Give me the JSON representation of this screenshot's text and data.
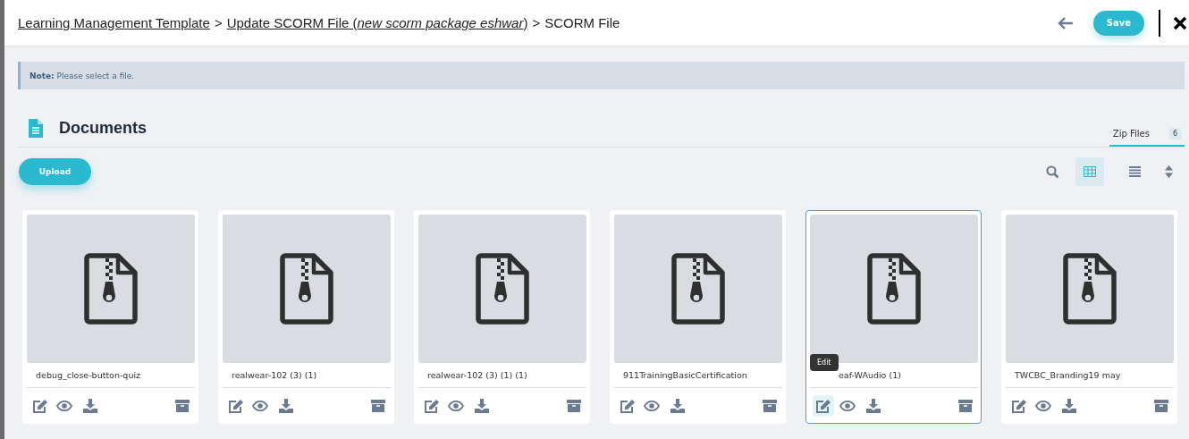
{
  "breadcrumb": {
    "links": [
      "Learning Management Template",
      "Update SCORM File (*new scorm package eshwar*)"
    ],
    "current": "SCORM File",
    "separator": ">"
  },
  "header": {
    "save": "Save"
  },
  "note": {
    "label": "Note:",
    "text": "Please select a file."
  },
  "section": {
    "title": "Documents"
  },
  "tabs": [
    {
      "label": "Zip Files",
      "count": "6",
      "selected": true
    }
  ],
  "toolbar": {
    "upload": "Upload",
    "views": [
      {
        "kind": "grid",
        "selected": true
      },
      {
        "kind": "list",
        "selected": false
      }
    ]
  },
  "files": [
    {
      "name": "debug_close-button-quiz",
      "selected": false
    },
    {
      "name": "realwear-102 (3) (1)",
      "selected": false
    },
    {
      "name": "realwear-102 (3) (1) (1)",
      "selected": false
    },
    {
      "name": "911TrainingBasicCertification",
      "selected": false
    },
    {
      "name": "eaf-WAudio (1)",
      "selected": true,
      "tooltip": "Edit"
    },
    {
      "name": "TWCBC_Branding19 may",
      "selected": false
    }
  ]
}
